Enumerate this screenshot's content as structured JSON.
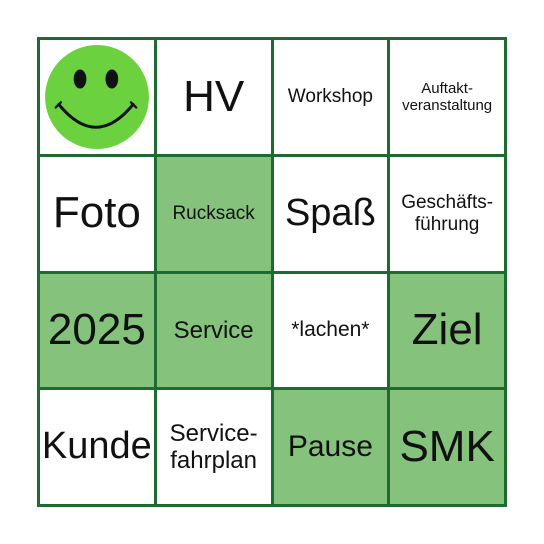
{
  "board": {
    "colors": {
      "border": "#1e6b32",
      "marked": "#85c27c",
      "unmarked": "#ffffff",
      "smiley": "#6cd13f"
    },
    "cells": [
      {
        "label": "",
        "icon": "smiley-face-icon",
        "marked": false
      },
      {
        "label": "HV",
        "marked": false
      },
      {
        "label": "Workshop",
        "marked": false
      },
      {
        "label": "Auftakt-\nveranstaltung",
        "marked": false
      },
      {
        "label": "Foto",
        "marked": false
      },
      {
        "label": "Rucksack",
        "marked": true
      },
      {
        "label": "Spaß",
        "marked": false
      },
      {
        "label": "Geschäfts-\nführung",
        "marked": false
      },
      {
        "label": "2025",
        "marked": true
      },
      {
        "label": "Service",
        "marked": true
      },
      {
        "label": "*lachen*",
        "marked": false
      },
      {
        "label": "Ziel",
        "marked": true
      },
      {
        "label": "Kunde",
        "marked": false
      },
      {
        "label": "Service-\nfahrplan",
        "marked": false
      },
      {
        "label": "Pause",
        "marked": true
      },
      {
        "label": "SMK",
        "marked": true
      }
    ]
  }
}
